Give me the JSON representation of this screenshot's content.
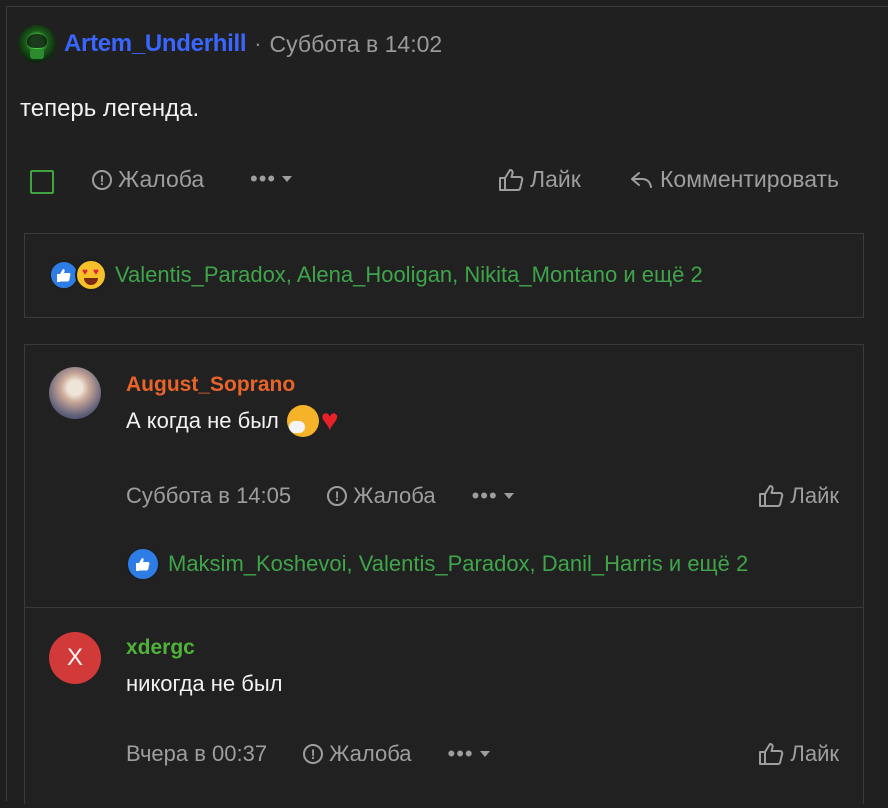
{
  "post": {
    "author": "Artem_Underhill",
    "separator": "·",
    "time": "Суббота в 14:02",
    "text": "теперь легенда.",
    "actions": {
      "report": "Жалоба",
      "more": "•••",
      "like": "Лайк",
      "comment": "Комментировать"
    },
    "reactions": {
      "names": "Valentis_Paradox, Alena_Hooligan, Nikita_Montano и ещё 2"
    }
  },
  "comments": [
    {
      "author": "August_Soprano",
      "author_color": "#e8642a",
      "text": "А когда не был",
      "time": "Суббота в 14:05",
      "report": "Жалоба",
      "more": "•••",
      "like": "Лайк",
      "reactions": "Maksim_Koshevoi, Valentis_Paradox, Danil_Harris и ещё 2"
    },
    {
      "author": "xdergc",
      "author_color": "#4fb33a",
      "avatar_letter": "X",
      "text": "никогда не был",
      "time": "Вчера в 00:37",
      "report": "Жалоба",
      "more": "•••",
      "like": "Лайк"
    }
  ],
  "colors": {
    "background": "#1f1f1f",
    "author_link": "#3a66ff",
    "reaction_names": "#3fa54a",
    "muted": "#9e9e9e"
  },
  "icons": [
    "avatar",
    "checkbox-icon",
    "report-icon",
    "chevron-down-icon",
    "thumbs-up-icon",
    "reply-icon",
    "like-reaction-icon",
    "heart-eyes-emoji-icon",
    "sneeze-emoji-icon",
    "heart-icon"
  ]
}
